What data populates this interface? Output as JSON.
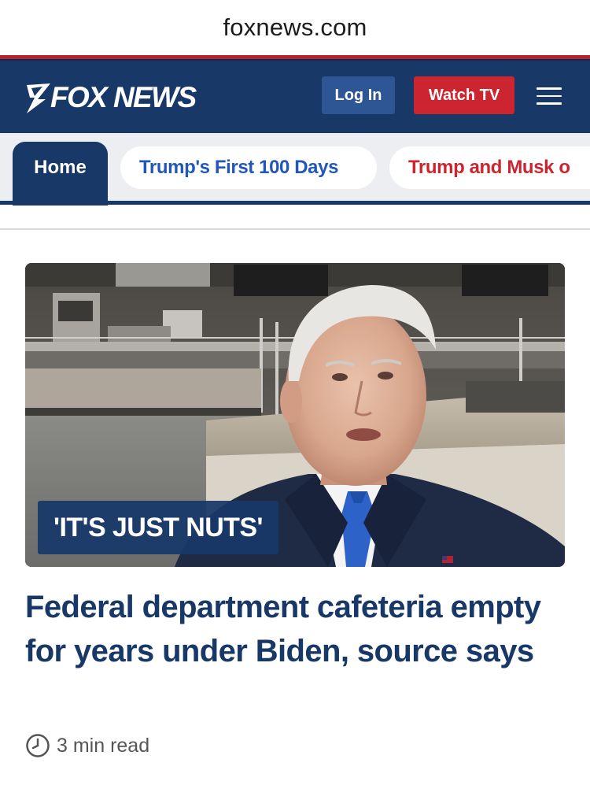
{
  "browser": {
    "url": "foxnews.com"
  },
  "header": {
    "logo_text": "FOX NEWS",
    "login_label": "Log In",
    "watch_label": "Watch TV",
    "menu_icon": "hamburger-menu-icon"
  },
  "nav": {
    "tabs": [
      {
        "label": "Home",
        "active": true
      },
      {
        "label": "Trump's First 100 Days",
        "color": "#2157b8"
      },
      {
        "label": "Trump and Musk o",
        "color": "#cc2530"
      }
    ]
  },
  "article": {
    "kicker": "'IT'S JUST NUTS'",
    "headline": "Federal department cafeteria empty for years under Biden, source says",
    "read_time": "3 min read",
    "clock_icon": "clock-icon"
  },
  "colors": {
    "brand_navy": "#183868",
    "brand_red": "#cc2530",
    "link_blue": "#2157b8"
  }
}
